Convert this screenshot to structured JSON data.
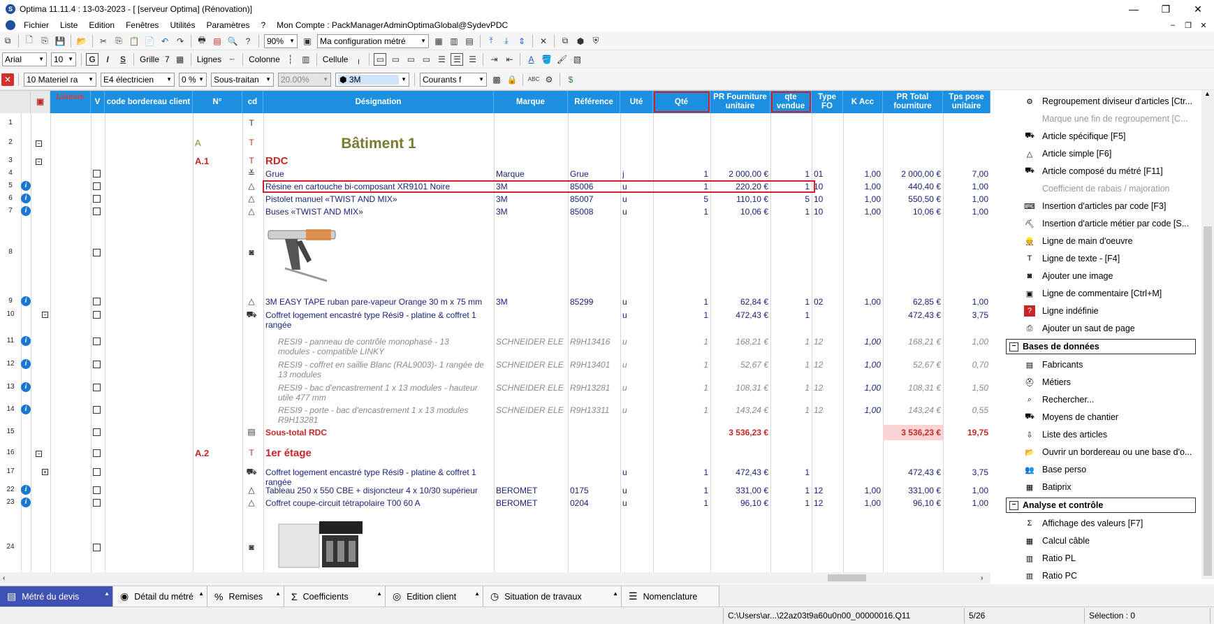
{
  "window": {
    "title": "Optima 11.11.4 : 13-03-2023 - [ [serveur Optima] (Rénovation)]",
    "minimize": "—",
    "maximize": "❐",
    "close": "✕"
  },
  "menu": [
    "Fichier",
    "Liste",
    "Edition",
    "Fenêtres",
    "Utilités",
    "Paramètres",
    "?",
    "Mon Compte : PackManagerAdminOptimaGlobal@SydevPDC"
  ],
  "mdi": {
    "minimize": "–",
    "restore": "❐",
    "close": "✕"
  },
  "toolbar1": {
    "zoom": "90%",
    "config": "Ma configuration métré"
  },
  "toolbar2": {
    "font": "Arial",
    "size": "10",
    "bold": "G",
    "italic": "I",
    "strike": "S",
    "grille_label": "Grille",
    "grille_value": "7",
    "lignes_label": "Lignes",
    "colonne_label": "Colonne",
    "cellule_label": "Cellule"
  },
  "toolbar3": {
    "lot": "10  Materiel ra",
    "metier": "E4  électricien",
    "pct": "0 %",
    "type": "Sous-traitan",
    "rate": "20.00%",
    "brand": "3M",
    "courants": "Courants f"
  },
  "columns": [
    {
      "key": "linexis",
      "label": "Linexis"
    },
    {
      "key": "v",
      "label": "V"
    },
    {
      "key": "code",
      "label": "code bordereau client"
    },
    {
      "key": "num",
      "label": "N°"
    },
    {
      "key": "cd",
      "label": "cd"
    },
    {
      "key": "des",
      "label": "Désignation"
    },
    {
      "key": "marque",
      "label": "Marque"
    },
    {
      "key": "ref",
      "label": "Référence"
    },
    {
      "key": "ute",
      "label": "Uté"
    },
    {
      "key": "qte",
      "label": "Qté"
    },
    {
      "key": "pru",
      "label": "PR Fourniture unitaire"
    },
    {
      "key": "qv",
      "label": "qte vendue"
    },
    {
      "key": "tfo",
      "label": "Type FO"
    },
    {
      "key": "kacc",
      "label": "K Acc"
    },
    {
      "key": "prt",
      "label": "PR Total fourniture"
    },
    {
      "key": "tps",
      "label": "Tps pose unitaire"
    }
  ],
  "rows": [
    {
      "n": "1"
    },
    {
      "n": "2",
      "num": "A",
      "des": "Bâtiment 1"
    },
    {
      "n": "3",
      "num": "A.1",
      "des": "RDC"
    },
    {
      "n": "4",
      "des": "Grue",
      "marque": "Marque",
      "ref": "Grue",
      "ute": "j",
      "qte": "1",
      "pru": "2 000,00 €",
      "qv": "1",
      "tfo": "01",
      "kacc": "1,00",
      "prt": "2 000,00 €",
      "tps": "7,00"
    },
    {
      "n": "5",
      "des": "Résine en cartouche bi-composant XR9101 Noire",
      "marque": "3M",
      "ref": "85006",
      "ute": "u",
      "qte": "1",
      "pru": "220,20 €",
      "qv": "1",
      "tfo": "10",
      "kacc": "1,00",
      "prt": "440,40 €",
      "tps": "1,00"
    },
    {
      "n": "6",
      "des": "Pistolet manuel «TWIST AND MIX»",
      "marque": "3M",
      "ref": "85007",
      "ute": "u",
      "qte": "5",
      "pru": "110,10 €",
      "qv": "5",
      "tfo": "10",
      "kacc": "1,00",
      "prt": "550,50 €",
      "tps": "1,00"
    },
    {
      "n": "7",
      "des": "Buses «TWIST AND MIX»",
      "marque": "3M",
      "ref": "85008",
      "ute": "u",
      "qte": "1",
      "pru": "10,06 €",
      "qv": "1",
      "tfo": "10",
      "kacc": "1,00",
      "prt": "10,06 €",
      "tps": "1,00"
    },
    {
      "n": "8"
    },
    {
      "n": "9",
      "des": "3M EASY TAPE ruban pare-vapeur Orange 30 m x 75 mm",
      "marque": "3M",
      "ref": "85299",
      "ute": "u",
      "qte": "1",
      "pru": "62,84 €",
      "qv": "1",
      "tfo": "02",
      "kacc": "1,00",
      "prt": "62,85 €",
      "tps": "1,00"
    },
    {
      "n": "10",
      "des": "Coffret logement encastré type Rési9 - platine & coffret 1",
      "des2": "rangée",
      "ute": "u",
      "qte": "1",
      "pru": "472,43 €",
      "qv": "1",
      "prt": "472,43 €",
      "tps": "3,75"
    },
    {
      "n": "11",
      "des": "RESI9 - panneau de contrôle monophasé - 13",
      "des2": "modules - compatible LINKY",
      "marque": "SCHNEIDER ELE",
      "ref": "R9H13416",
      "ute": "u",
      "qte": "1",
      "pru": "168,21 €",
      "qv": "1",
      "tfo": "12",
      "kacc": "1,00",
      "prt": "168,21 €",
      "tps": "1,00"
    },
    {
      "n": "12",
      "des": "RESI9 - coffret en saillie Blanc (RAL9003)- 1 rangée de",
      "des2": "13 modules",
      "marque": "SCHNEIDER ELE",
      "ref": "R9H13401",
      "ute": "u",
      "qte": "1",
      "pru": "52,67 €",
      "qv": "1",
      "tfo": "12",
      "kacc": "1,00",
      "prt": "52,67 €",
      "tps": "0,70"
    },
    {
      "n": "13",
      "des": "RESI9 - bac d'encastrement 1 x 13 modules - hauteur",
      "des2": "utile 477 mm",
      "marque": "SCHNEIDER ELE",
      "ref": "R9H13281",
      "ute": "u",
      "qte": "1",
      "pru": "108,31 €",
      "qv": "1",
      "tfo": "12",
      "kacc": "1,00",
      "prt": "108,31 €",
      "tps": "1,50"
    },
    {
      "n": "14",
      "des": "RESI9 - porte - bac d'encastrement 1 x 13 modules",
      "des2": "R9H13281",
      "marque": "SCHNEIDER ELE",
      "ref": "R9H13311",
      "ute": "u",
      "qte": "1",
      "pru": "143,24 €",
      "qv": "1",
      "tfo": "12",
      "kacc": "1,00",
      "prt": "143,24 €",
      "tps": "0,55"
    },
    {
      "n": "15",
      "des": "Sous-total RDC",
      "pru": "3 536,23 €",
      "prt": "3 536,23 €",
      "tps": "19,75"
    },
    {
      "n": "16",
      "num": "A.2",
      "des": "1er étage"
    },
    {
      "n": "17",
      "des": "Coffret logement encastré type Rési9 - platine & coffret 1",
      "des2": "rangée",
      "ute": "u",
      "qte": "1",
      "pru": "472,43 €",
      "qv": "1",
      "prt": "472,43 €",
      "tps": "3,75"
    },
    {
      "n": "22",
      "des": "Tableau 250 x 550 CBE + disjoncteur 4 x 10/30 supérieur",
      "marque": "BEROMET",
      "ref": "0175",
      "ute": "u",
      "qte": "1",
      "pru": "331,00 €",
      "qv": "1",
      "tfo": "12",
      "kacc": "1,00",
      "prt": "331,00 €",
      "tps": "1,00"
    },
    {
      "n": "23",
      "des": "Coffret coupe-circuit tétrapolaire T00 60 A",
      "marque": "BEROMET",
      "ref": "0204",
      "ute": "u",
      "qte": "1",
      "pru": "96,10 €",
      "qv": "1",
      "tfo": "12",
      "kacc": "1,00",
      "prt": "96,10 €",
      "tps": "1,00"
    },
    {
      "n": "24"
    }
  ],
  "panel": {
    "items1": [
      {
        "label": "Regroupement diviseur d'articles [Ctr...",
        "icon": "group-icon"
      },
      {
        "label": "Marque une fin de regroupement  [C...",
        "icon": "",
        "disabled": true
      },
      {
        "label": "Article spécifique [F5]",
        "icon": "specific-article-icon"
      },
      {
        "label": "Article simple [F6]",
        "icon": "simple-article-icon"
      },
      {
        "label": "Article composé du métré [F11]",
        "icon": "composed-article-icon"
      },
      {
        "label": "Coefficient de rabais / majoration",
        "icon": "",
        "disabled": true
      },
      {
        "label": "Insertion d'articles par code [F3]",
        "icon": "code-insert-icon"
      },
      {
        "label": "Insertion d'article métier par code [S...",
        "icon": "trade-insert-icon"
      },
      {
        "label": "Ligne de main d'oeuvre",
        "icon": "worker-icon"
      },
      {
        "label": "Ligne de texte - [F4]",
        "icon": "text-line-icon"
      },
      {
        "label": "Ajouter une image",
        "icon": "camera-icon"
      },
      {
        "label": "Ligne de commentaire [Ctrl+M]",
        "icon": "comment-icon"
      },
      {
        "label": "Ligne indéfinie",
        "icon": "question-icon"
      },
      {
        "label": "Ajouter un saut de page",
        "icon": "page-break-icon"
      }
    ],
    "section2": "Bases de données",
    "items2": [
      {
        "label": "Fabricants",
        "icon": "manufacturers-icon"
      },
      {
        "label": "Métiers",
        "icon": "trades-icon"
      },
      {
        "label": "Rechercher...",
        "icon": "binoculars-icon"
      },
      {
        "label": "Moyens de chantier",
        "icon": "site-means-icon"
      },
      {
        "label": "Liste des articles",
        "icon": "article-list-icon"
      },
      {
        "label": "Ouvrir un bordereau ou une base d'o...",
        "icon": "open-folder-icon"
      },
      {
        "label": "Base perso",
        "icon": "personal-base-icon"
      },
      {
        "label": "Batiprix",
        "icon": "batiprix-icon"
      }
    ],
    "section3": "Analyse et contrôle",
    "items3": [
      {
        "label": "Affichage des valeurs [F7]",
        "icon": "sigma-icon"
      },
      {
        "label": "Calcul câble",
        "icon": "calculator-icon"
      },
      {
        "label": "Ratio PL",
        "icon": "ratio-pl-icon"
      },
      {
        "label": "Ratio PC",
        "icon": "ratio-pc-icon"
      }
    ]
  },
  "tabs": [
    {
      "label": "Métré du devis",
      "active": true
    },
    {
      "label": "Détail du métré"
    },
    {
      "label": "Remises"
    },
    {
      "label": "Coefficients"
    },
    {
      "label": "Edition client"
    },
    {
      "label": "Situation de travaux"
    },
    {
      "label": "Nomenclature"
    }
  ],
  "status": {
    "path": "C:\\Users\\ar...\\22az03t9a60u0n00_00000016.Q11",
    "page": "5/26",
    "selection": "Sélection : 0"
  }
}
